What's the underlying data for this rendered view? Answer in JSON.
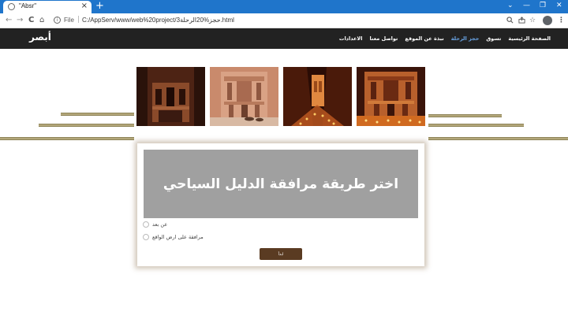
{
  "browser": {
    "tab_title": "\"Absr\"",
    "tab_close": "×",
    "new_tab": "+",
    "window_controls": [
      "⌄",
      "—",
      "❐",
      "✕"
    ],
    "nav_buttons": [
      "←",
      "→",
      "C",
      "⌂"
    ],
    "info_icon": "i",
    "file_label": "File",
    "url": "C:/AppServ/www/web%20project/3حجز%20الرحلة.html",
    "toolbar_icons": [
      "search-icon",
      "share-icon",
      "star-icon",
      "profile-icon",
      "menu-icon"
    ]
  },
  "header": {
    "logo": "أبصر",
    "nav": [
      "الصفحة الرئيسية",
      "تسوق",
      "حجز الرحلة",
      "نبذة عن الموقع",
      "تواصل معنا",
      "الاعدادات"
    ],
    "active_nav_index": 2,
    "active_color": "#6aa5e6"
  },
  "gallery": {
    "images": [
      "petra-treasury-night",
      "petra-treasury-day-camels",
      "petra-siq-candles",
      "petra-treasury-candlelight"
    ]
  },
  "card": {
    "title": "اختر طريقة مرافقة الدليل السياحي",
    "options": [
      "عن بعد",
      "مرافقة على ارض الواقع"
    ],
    "submit_label": "ابدأ"
  },
  "colors": {
    "header_bg": "#222222",
    "gold_line": "#b3a77a",
    "banner_bg": "#a0a0a0",
    "button_bg": "#5a3b22"
  }
}
